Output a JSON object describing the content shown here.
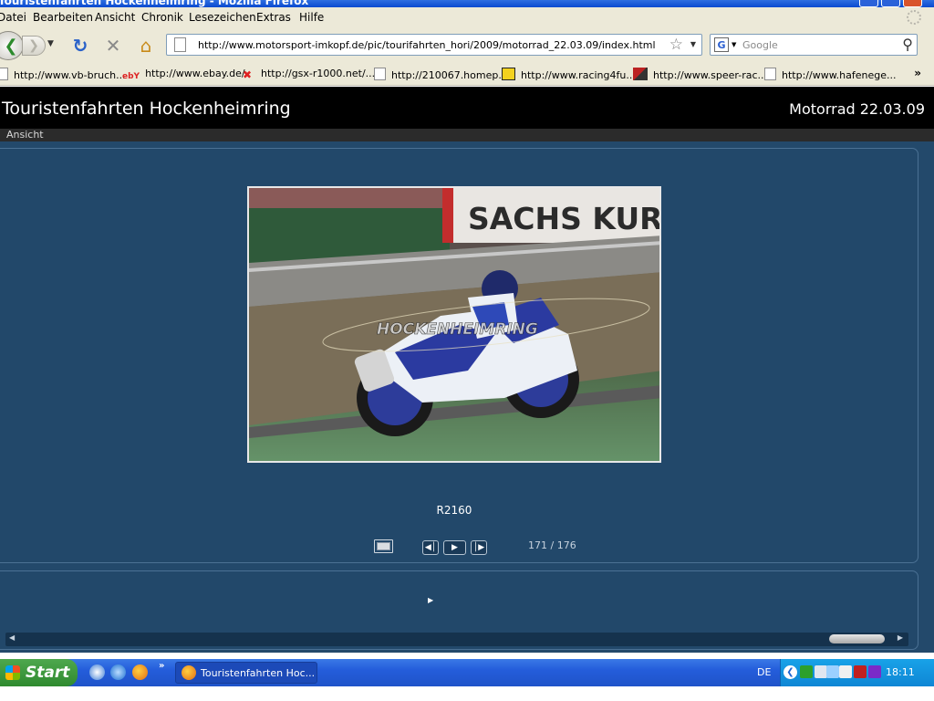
{
  "window": {
    "title": "Touristenfahrten Hockenheimring - Mozilla Firefox"
  },
  "menubar": {
    "items": [
      "Datei",
      "Bearbeiten",
      "Ansicht",
      "Chronik",
      "Lesezeichen",
      "Extras",
      "Hilfe"
    ]
  },
  "navbar": {
    "url": "http://www.motorsport-imkopf.de/pic/tourifahrten_hori/2009/motorrad_22.03.09/index.html",
    "search_placeholder": "Google"
  },
  "bookmarks": {
    "items": [
      "http://www.vb-bruch...",
      "http://www.ebay.de/",
      "http://gsx-r1000.net/...",
      "http://210067.homep...",
      "http://www.racing4fu...",
      "http://www.speer-rac...",
      "http://www.hafenege..."
    ],
    "more": "»"
  },
  "page": {
    "site_title": "Touristenfahrten Hockenheimring",
    "date_title": "Motorrad 22.03.09",
    "view_menu": "Ansicht",
    "photo": {
      "banner_text": "SACHS KUR",
      "watermark": "HOCKENHEIMRING"
    },
    "caption": "R2160",
    "counter": "171 / 176"
  },
  "taskbar": {
    "start_label": "Start",
    "task_label": "Touristenfahrten Hoc...",
    "language": "DE",
    "clock": "18:11",
    "quicklaunch_more": "»"
  },
  "colors": {
    "page_bg": "#23496b",
    "header_bg": "#000000",
    "taskbar_blue": "#245ddb",
    "start_green": "#3c9a3c"
  }
}
